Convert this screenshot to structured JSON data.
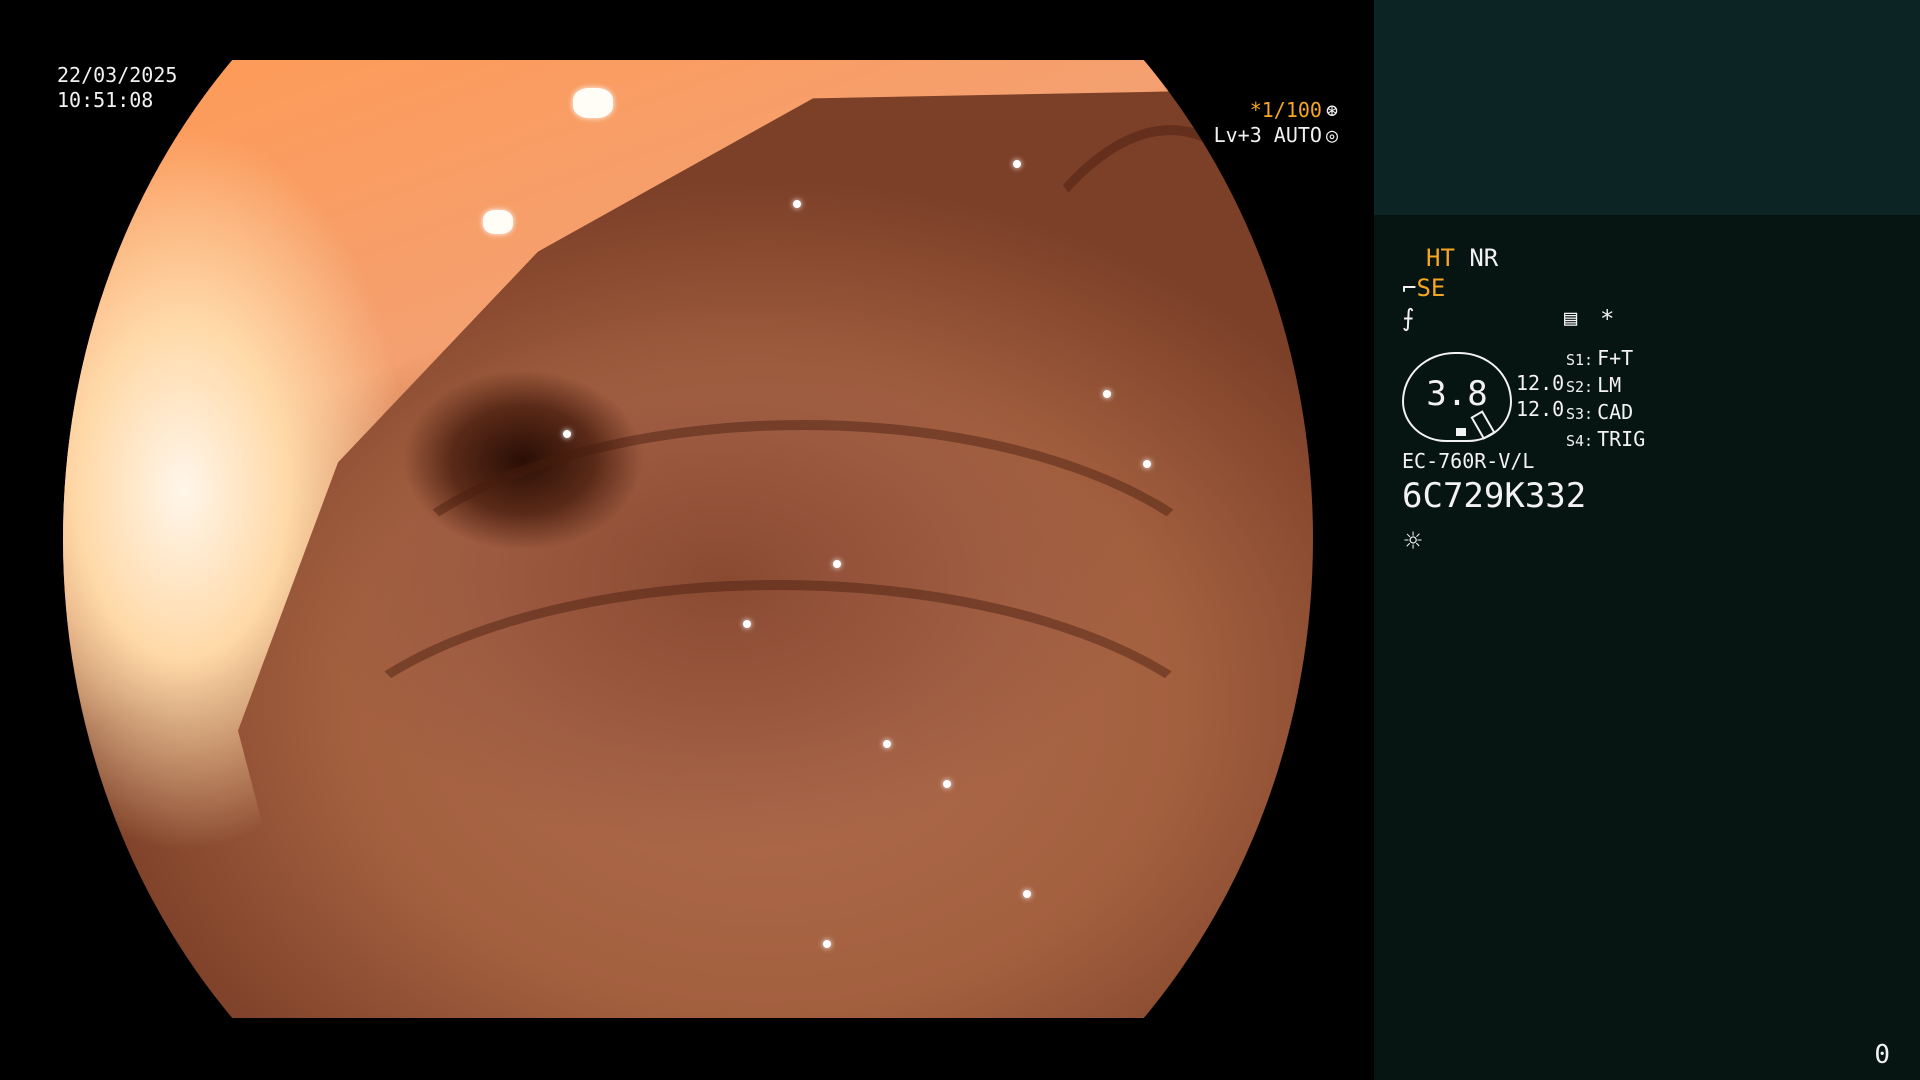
{
  "overlay": {
    "date": "22/03/2025",
    "time": "10:51:08",
    "shutter": "*1/100",
    "shutter_icon": "aperture-icon",
    "light_level": "Lv+3 AUTO",
    "light_icon": "iris-icon"
  },
  "panel": {
    "ht": "HT",
    "nr": "NR",
    "se": "SE",
    "se_icon": "scope-tip-icon",
    "curve_icon": "gamma-curve-icon",
    "menu_icon": "list-icon",
    "star": "*",
    "gauge_value": "3.8",
    "readings": [
      "12.0",
      "12.0"
    ],
    "switches": [
      {
        "key": "S1:",
        "value": "F+T"
      },
      {
        "key": "S2:",
        "value": "LM"
      },
      {
        "key": "S3:",
        "value": "CAD"
      },
      {
        "key": "S4:",
        "value": "TRIG"
      }
    ],
    "model": "EC-760R-V/L",
    "serial": "6C729K332",
    "light_source_icon": "sun-icon",
    "counter": "0"
  },
  "colors": {
    "accent": "#f5a623",
    "panel_bg": "#061412",
    "panel_top_bg": "#0d2425",
    "text": "#f2f2f2"
  }
}
